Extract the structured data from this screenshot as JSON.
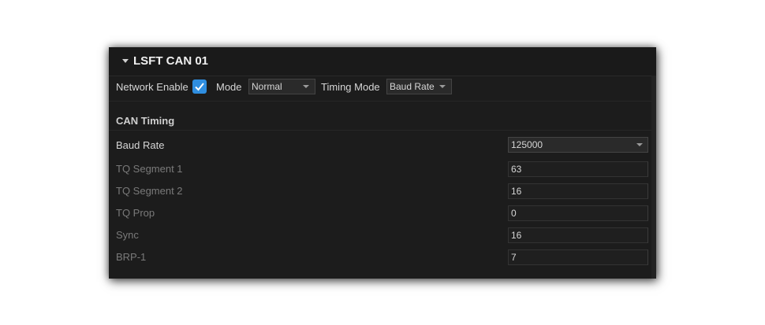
{
  "panel": {
    "title": "LSFT CAN 01"
  },
  "toolbar": {
    "network_enable_label": "Network Enable",
    "network_enable_checked": true,
    "mode_label": "Mode",
    "mode_value": "Normal",
    "timing_mode_label": "Timing Mode",
    "timing_mode_value": "Baud Rate"
  },
  "section": {
    "title": "CAN Timing"
  },
  "fields": {
    "baud_rate": {
      "label": "Baud Rate",
      "value": "125000"
    },
    "tq_segment_1": {
      "label": "TQ Segment 1",
      "value": "63"
    },
    "tq_segment_2": {
      "label": "TQ Segment 2",
      "value": "16"
    },
    "tq_prop": {
      "label": "TQ Prop",
      "value": "0"
    },
    "sync": {
      "label": "Sync",
      "value": "16"
    },
    "brp_1": {
      "label": "BRP-1",
      "value": "7"
    }
  },
  "colors": {
    "accent": "#2f8ee0",
    "panel_bg": "#1c1c1c",
    "text": "#d6d6d6",
    "disabled_text": "#7a7a7a"
  }
}
